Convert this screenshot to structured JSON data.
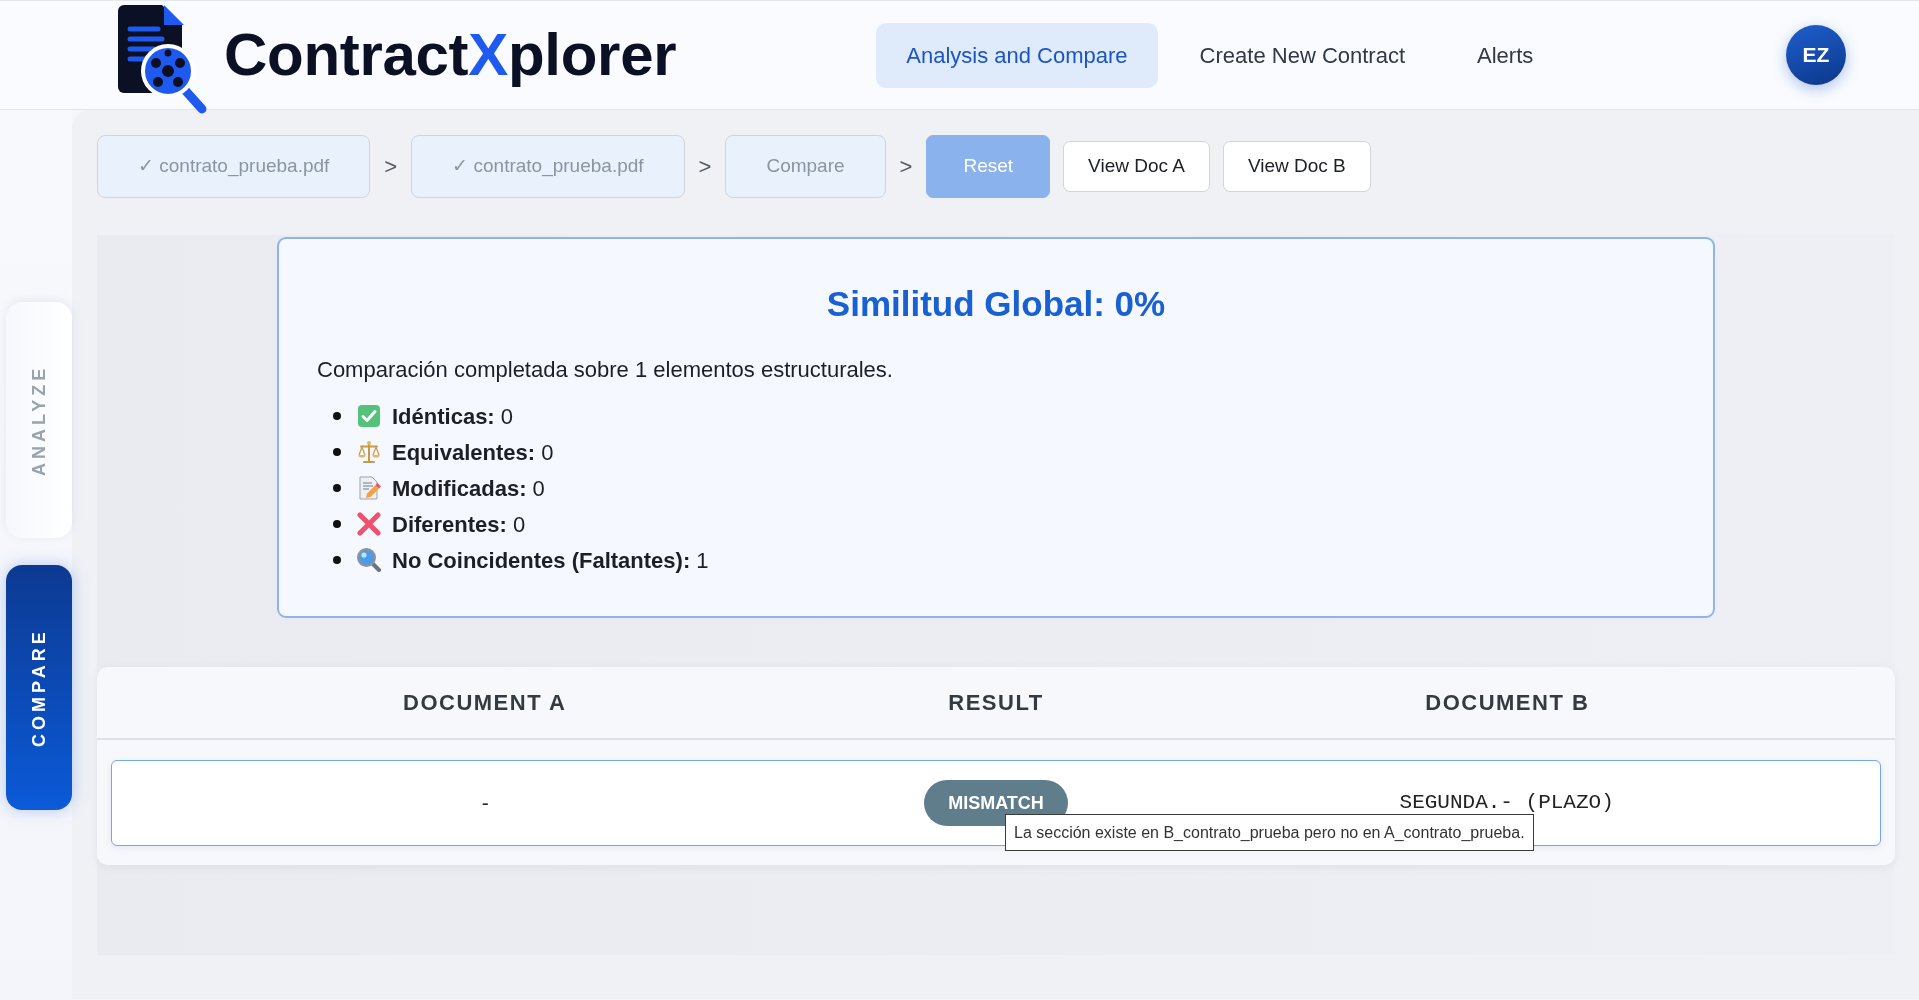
{
  "header": {
    "logo": {
      "start": "Contract",
      "accent": "X",
      "end": "plorer"
    },
    "nav": [
      {
        "label": "Analysis and Compare",
        "selected": true
      },
      {
        "label": "Create New Contract",
        "selected": false
      },
      {
        "label": "Alerts",
        "selected": false
      }
    ],
    "avatar": "EZ"
  },
  "sidebar": {
    "tabs": [
      {
        "label": "ANALYZE",
        "selected": false
      },
      {
        "label": "COMPARE",
        "selected": true
      }
    ]
  },
  "breadcrumb": {
    "steps": [
      {
        "label": "✓ contrato_prueba.pdf",
        "separator": ">"
      },
      {
        "label": "✓ contrato_prueba.pdf",
        "separator": ">"
      },
      {
        "label": "Compare",
        "separator": ">"
      }
    ]
  },
  "actions": [
    {
      "label": "Reset",
      "kind": "primary"
    },
    {
      "label": "View Doc A",
      "kind": "outline"
    },
    {
      "label": "View Doc B",
      "kind": "outline"
    }
  ],
  "summary": {
    "title": "Similitud Global: 0%",
    "intro": "Comparación completada sobre 1 elementos estructurales.",
    "stats": [
      {
        "kind": "identical",
        "text": "**Idénticas:** 0"
      },
      {
        "kind": "equivalent",
        "text": "**Equivalentes:** 0"
      },
      {
        "kind": "modified",
        "text": "**Modificadas:** 0"
      },
      {
        "kind": "different",
        "text": "**Diferentes:** 0"
      },
      {
        "kind": "missing",
        "text": "**No Coincidentes (Faltantes):** 1"
      }
    ]
  },
  "table": {
    "columns": [
      "DOCUMENT A",
      "RESULT",
      "DOCUMENT B"
    ],
    "rows": [
      {
        "document_a": "-",
        "result": {
          "label": "MISMATCH",
          "kind": "mismatch",
          "tooltip": "La sección existe en B_contrato_prueba pero no en A_contrato_prueba."
        },
        "document_b": "SEGUNDA.- (PLAZO)"
      }
    ]
  }
}
